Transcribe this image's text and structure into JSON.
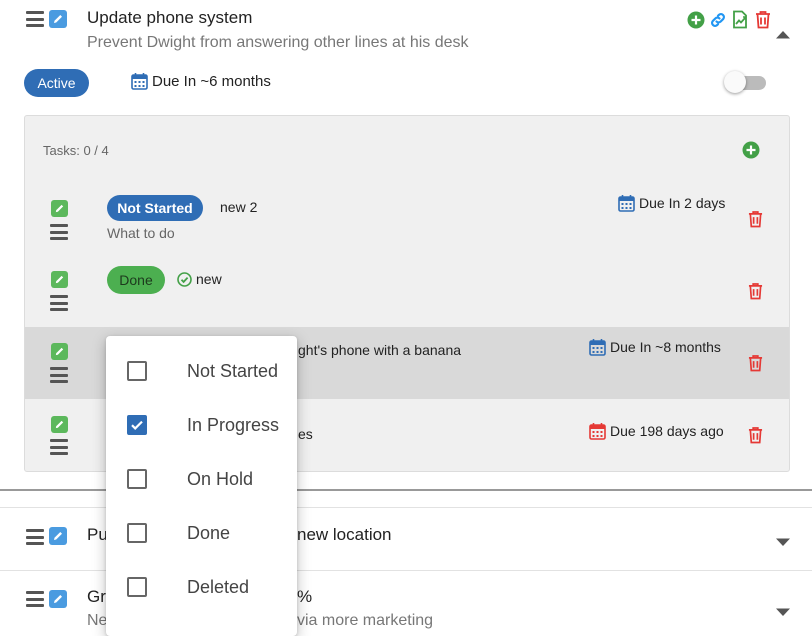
{
  "project": {
    "title": "Update phone system",
    "subtitle": "Prevent Dwight from answering other lines at his desk",
    "status": "Active",
    "due": "Due In ~6 months"
  },
  "tasks_panel": {
    "count_label": "Tasks: 0 / 4",
    "tasks": [
      {
        "status": "Not Started",
        "name": "new 2",
        "description": "What to do",
        "due": "Due In 2 days"
      },
      {
        "status": "Done",
        "name": "new",
        "due": ""
      },
      {
        "name": "ght's phone with a banana",
        "due": "Due In ~8 months"
      },
      {
        "name": "es",
        "due": "Due 198 days ago"
      }
    ]
  },
  "other_projects": [
    {
      "title_left": "Pu",
      "title_right": "new location"
    },
    {
      "title_left": "Gr",
      "title_right": "%",
      "subtitle_left": "Ne",
      "subtitle_right": "via more marketing"
    }
  ],
  "status_menu": {
    "options": [
      {
        "label": "Not Started",
        "checked": false
      },
      {
        "label": "In Progress",
        "checked": true
      },
      {
        "label": "On Hold",
        "checked": false
      },
      {
        "label": "Done",
        "checked": false
      },
      {
        "label": "Deleted",
        "checked": false
      }
    ]
  },
  "colors": {
    "primary": "#2f6db5",
    "success": "#4caf50",
    "danger": "#e53935",
    "link": "#2196f3"
  }
}
